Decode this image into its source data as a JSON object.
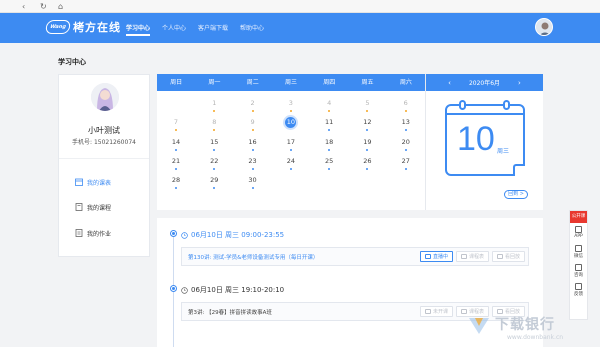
{
  "app": {
    "logo_badge": "Wang",
    "logo_text": "栲方在线"
  },
  "nav": {
    "tabs": [
      {
        "label": "学习中心",
        "active": true
      },
      {
        "label": "个人中心",
        "active": false
      },
      {
        "label": "客户端下载",
        "active": false
      },
      {
        "label": "帮助中心",
        "active": false
      }
    ]
  },
  "page": {
    "title": "学习中心"
  },
  "profile": {
    "name": "小叶测试",
    "phone": "手机号: 15021260074",
    "menu": [
      {
        "label": "我的课表",
        "icon": "calendar-icon",
        "active": true
      },
      {
        "label": "我的课程",
        "icon": "book-icon",
        "active": false
      },
      {
        "label": "我的作业",
        "icon": "homework-icon",
        "active": false
      }
    ]
  },
  "calendar": {
    "weekdays": [
      "周日",
      "周一",
      "周二",
      "周三",
      "周四",
      "周五",
      "周六"
    ],
    "rows": [
      [
        null,
        {
          "d": "1",
          "dot": "orange",
          "prev": true
        },
        {
          "d": "2",
          "dot": "orange",
          "prev": true
        },
        {
          "d": "3",
          "dot": "orange",
          "prev": true
        },
        {
          "d": "4",
          "dot": "orange",
          "prev": true
        },
        {
          "d": "5",
          "dot": "orange",
          "prev": true
        },
        {
          "d": "6",
          "dot": "orange",
          "prev": true
        }
      ],
      [
        {
          "d": "7",
          "dot": "orange",
          "prev": true
        },
        {
          "d": "8",
          "dot": "orange",
          "prev": true
        },
        {
          "d": "9",
          "dot": "orange",
          "prev": true
        },
        {
          "d": "10",
          "dot": "",
          "today": true
        },
        {
          "d": "11",
          "dot": "blue"
        },
        {
          "d": "12",
          "dot": "blue"
        },
        {
          "d": "13",
          "dot": "blue"
        }
      ],
      [
        {
          "d": "14",
          "dot": "blue"
        },
        {
          "d": "15",
          "dot": "blue"
        },
        {
          "d": "16",
          "dot": "blue"
        },
        {
          "d": "17",
          "dot": "blue"
        },
        {
          "d": "18",
          "dot": "blue"
        },
        {
          "d": "19",
          "dot": "blue"
        },
        {
          "d": "20",
          "dot": "blue"
        }
      ],
      [
        {
          "d": "21",
          "dot": "blue"
        },
        {
          "d": "22",
          "dot": "blue"
        },
        {
          "d": "23",
          "dot": "blue"
        },
        {
          "d": "24",
          "dot": "blue"
        },
        {
          "d": "25",
          "dot": "blue"
        },
        {
          "d": "26",
          "dot": "blue"
        },
        {
          "d": "27",
          "dot": "blue"
        }
      ],
      [
        {
          "d": "28",
          "dot": "blue"
        },
        {
          "d": "29",
          "dot": "blue"
        },
        {
          "d": "30",
          "dot": "blue"
        },
        null,
        null,
        null,
        null
      ]
    ]
  },
  "datecard": {
    "month_label": "2020年6月",
    "prev": "‹",
    "next": "›",
    "day": "10",
    "weekday": "周三",
    "back_button": "回到 >"
  },
  "schedule": [
    {
      "date": "06月10日 周三 09:00-23:55",
      "highlight": true,
      "lesson": "第130讲: 测试-学员&老师设备测试专用（每日开课）",
      "buttons": [
        {
          "label": "直播中",
          "primary": true
        },
        {
          "label": "课程表",
          "primary": false
        },
        {
          "label": "看回放",
          "primary": false
        }
      ]
    },
    {
      "date": "06月10日 周三 19:10-20:10",
      "highlight": false,
      "lesson": "第3讲: 【29春】拼音拼读故事A班",
      "buttons": [
        {
          "label": "未开课",
          "primary": false
        },
        {
          "label": "课程表",
          "primary": false
        },
        {
          "label": "看回放",
          "primary": false
        }
      ]
    }
  ],
  "float_bar": {
    "top": "公开课",
    "items": [
      {
        "label": "APP",
        "icon": "app-download-icon"
      },
      {
        "label": "微信",
        "icon": "wechat-icon"
      },
      {
        "label": "咨询",
        "icon": "chat-icon"
      },
      {
        "label": "反馈",
        "icon": "feedback-icon"
      }
    ]
  },
  "watermark": {
    "title": "下载银行",
    "url": "www.downbank.cn"
  },
  "colors": {
    "brand": "#3d8bf2",
    "accent": "#f5a623",
    "red": "#e8382f"
  }
}
